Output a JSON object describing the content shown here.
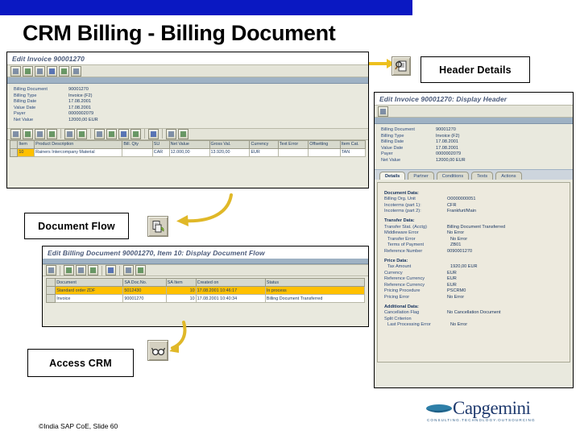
{
  "slide": {
    "title": "CRM Billing - Billing Document",
    "footer": "©India SAP CoE, Slide 60",
    "banner_color": "#0a18c2"
  },
  "callouts": {
    "header_details": "Header Details",
    "document_flow": "Document Flow",
    "access_crm": "Access CRM"
  },
  "invoice_window": {
    "title": "Edit Invoice 90001270",
    "toolbar_icons": [
      "back-icon",
      "refresh-icon",
      "history-icon",
      "copy-icon",
      "header-details-icon",
      "print-icon"
    ],
    "header_fields": [
      {
        "label": "Billing Document",
        "value": "90001270"
      },
      {
        "label": "Billing Type",
        "value": "Invoice (F2)"
      },
      {
        "label": "Billing Date",
        "value": "17.08.2001"
      },
      {
        "label": "Value Date",
        "value": "17.08.2001"
      },
      {
        "label": "Payer",
        "value": "0000002079"
      },
      {
        "label": "Net Value",
        "value": "12000,00 EUR"
      }
    ],
    "item_toolbar_icons": [
      "print-icon",
      "filter-icon",
      "sort-icon",
      "find-icon",
      "total-icon",
      "subtotal-icon",
      "export-icon",
      "detail-icon",
      "layout-icon",
      "grid-icon",
      "info-icon",
      "search-icon",
      "refresh-icon"
    ],
    "item_columns": [
      "Item",
      "Product Description",
      "Bill. Qty",
      "SU",
      "Net Value",
      "Gross Val.",
      "Currency",
      "Text Error",
      "Offsetting",
      "Item Cat."
    ],
    "item_rows": [
      {
        "item": "10",
        "description": "Rainers Intercompany Material",
        "bill_qty": "",
        "su": "CAR",
        "net_value": "12.000,00",
        "gross_value": "13.920,00",
        "currency": "EUR",
        "text_error": "",
        "offsetting": "",
        "item_cat": "TAN"
      }
    ]
  },
  "header_window": {
    "title": "Edit Invoice 90001270: Display Header",
    "toolbar_icons": [
      "display-icon"
    ],
    "summary_fields": [
      {
        "label": "Billing Document",
        "value": "90001270"
      },
      {
        "label": "Billing Type",
        "value": "Invoice (F2)"
      },
      {
        "label": "Billing Date",
        "value": "17.08.2001"
      },
      {
        "label": "Value Date",
        "value": "17.08.2001"
      },
      {
        "label": "Payer",
        "value": "0000002079"
      },
      {
        "label": "Net Value",
        "value": "12000,00 EUR"
      }
    ],
    "tabs": [
      "Details",
      "Partner",
      "Conditions",
      "Texts",
      "Actions"
    ],
    "active_tab": "Details",
    "detail_sections": [
      {
        "heading": "Document Data:",
        "fields": [
          {
            "label": "Billing Org. Unit",
            "value": "O0000000051"
          },
          {
            "label": "Incoterms (part 1):",
            "value": "CFR"
          },
          {
            "label": "Incoterms (part 2):",
            "value": "Frankfurt/Main"
          }
        ]
      },
      {
        "heading": "Transfer Data:",
        "fields": [
          {
            "label": "Transfer Stat. (Acctg)",
            "value": "Billing Document Transferred"
          },
          {
            "label": "Middleware Error",
            "value": "No Error"
          },
          {
            "label": "Transfer Error",
            "value": "No Error"
          },
          {
            "label": "Terms of Payment",
            "value": "ZB01"
          },
          {
            "label": "Reference Number",
            "value": "0090001270"
          }
        ]
      },
      {
        "heading": "Price Data:",
        "fields": [
          {
            "label": "Tax Amount",
            "value": "1920,00 EUR"
          },
          {
            "label": "Currency",
            "value": "EUR"
          },
          {
            "label": "Reference Currency",
            "value": "EUR"
          },
          {
            "label": "Reference Currency",
            "value": "EUR"
          },
          {
            "label": "Pricing Procedure",
            "value": "PSCRM0"
          },
          {
            "label": "Pricing Error",
            "value": "No Error"
          }
        ]
      },
      {
        "heading": "Additional Data:",
        "fields": [
          {
            "label": "Cancellation Flag",
            "value": "No Cancellation Document"
          },
          {
            "label": "Split Criterion",
            "value": ""
          },
          {
            "label": "Last Processing Error",
            "value": "No Error"
          }
        ]
      }
    ]
  },
  "flow_window": {
    "title": "Edit Billing Document 90001270, Item 10: Display Document Flow",
    "toolbar_icons": [
      "print-icon",
      "refresh-icon",
      "export-icon",
      "grid-icon",
      "info-icon",
      "find-icon",
      "detail-icon"
    ],
    "columns": [
      "Document",
      "SA Doc.No.",
      "SA Item",
      "Created on",
      "Status"
    ],
    "rows": [
      {
        "document": "Standard order ZDF",
        "doc_no": "5012430",
        "item": "10",
        "created_on": "17.08.2001 10:46:17",
        "status": "In process",
        "selected": true
      },
      {
        "document": "Invoice",
        "doc_no": "90001270",
        "item": "10",
        "created_on": "17.08.2001 10:40:34",
        "status": "Billing Document Transferred",
        "selected": false
      }
    ]
  },
  "logo": {
    "name": "Capgemini",
    "tagline": "CONSULTING.TECHNOLOGY.OUTSOURCING"
  }
}
